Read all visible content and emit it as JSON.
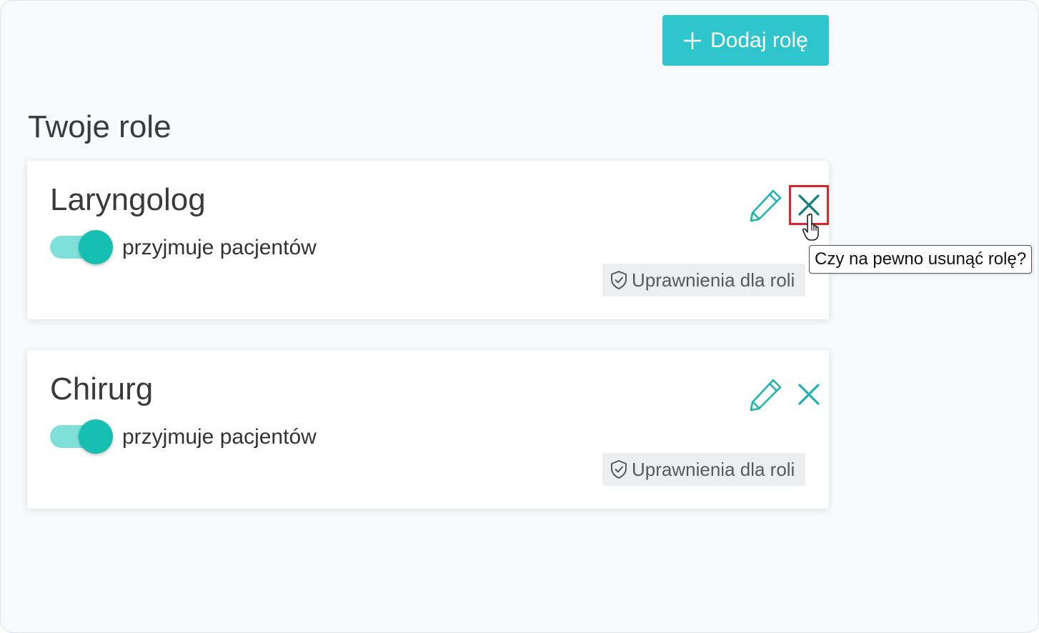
{
  "header": {
    "add_role_label": "Dodaj rolę",
    "add_icon": "plus-icon"
  },
  "page": {
    "title": "Twoje role"
  },
  "roles": [
    {
      "name": "Laryngolog",
      "accepts_patients": true,
      "toggle_label": "przyjmuje pacjentów",
      "permissions_label": "Uprawnienia dla roli"
    },
    {
      "name": "Chirurg",
      "accepts_patients": true,
      "toggle_label": "przyjmuje pacjentów",
      "permissions_label": "Uprawnienia dla roli"
    }
  ],
  "tooltip": {
    "text": "Czy na pewno usunąć rolę?"
  },
  "colors": {
    "accent": "#2ec6cc",
    "toggle_knob": "#16bfb1",
    "toggle_track": "#7fe0da",
    "icon_teal": "#1fb3ad",
    "highlight_red": "#d9262c"
  },
  "icons": {
    "edit": "pencil-icon",
    "delete": "close-icon",
    "permissions": "shield-check-icon",
    "cursor": "hand-pointer-icon"
  }
}
